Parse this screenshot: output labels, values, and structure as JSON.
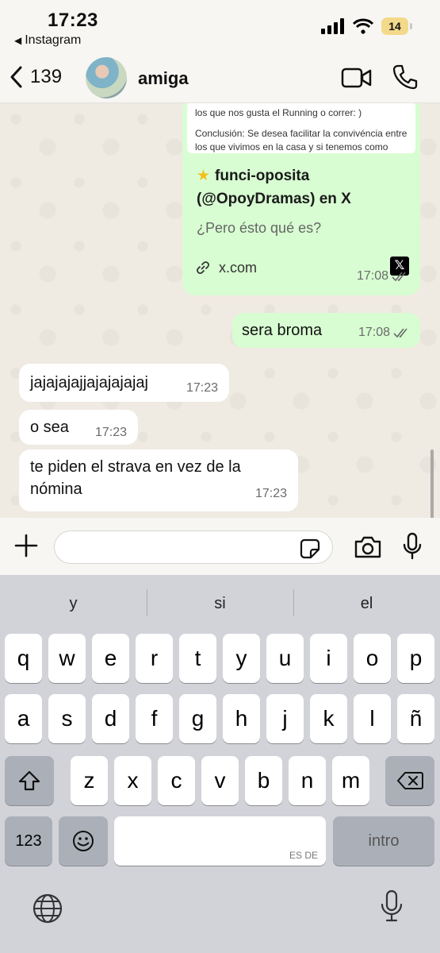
{
  "status_bar": {
    "time": "17:23",
    "back_app": "Instagram",
    "battery": "14"
  },
  "header": {
    "back_count": "139",
    "contact_name": "amiga"
  },
  "messages": {
    "link_card": {
      "preview_line1": "los que nos gusta el Running o correr: )",
      "preview_line2": "Conclusión: Se desea facilitar la convivéncia entre",
      "preview_line3": "los que vivimos en la casa y si tenemos como",
      "title_line1": "funci-oposita",
      "title_line2": "(@OpoyDramas) en X",
      "description": "¿Pero ésto qué es?",
      "domain": "x.com",
      "time": "17:08"
    },
    "sera": {
      "text": "sera broma",
      "time": "17:08"
    },
    "ja": {
      "text": "jajajajajjajajajajaj",
      "time": "17:23"
    },
    "osea": {
      "text": "o sea",
      "time": "17:23"
    },
    "strava": {
      "text": "te piden el strava en vez de la nómina",
      "time": "17:23"
    }
  },
  "input": {
    "value": "",
    "placeholder": ""
  },
  "keyboard": {
    "suggestions": [
      "y",
      "si",
      "el"
    ],
    "row1": [
      "q",
      "w",
      "e",
      "r",
      "t",
      "y",
      "u",
      "i",
      "o",
      "p"
    ],
    "row2": [
      "a",
      "s",
      "d",
      "f",
      "g",
      "h",
      "j",
      "k",
      "l",
      "ñ"
    ],
    "row3": [
      "z",
      "x",
      "c",
      "v",
      "b",
      "n",
      "m"
    ],
    "numbers_key": "123",
    "return_key": "intro",
    "space_lang": "ES DE"
  },
  "colors": {
    "outgoing_bubble": "#d8fdd2",
    "incoming_bubble": "#ffffff",
    "chat_bg": "#efeae2",
    "keyboard_bg": "#d1d3d9"
  }
}
